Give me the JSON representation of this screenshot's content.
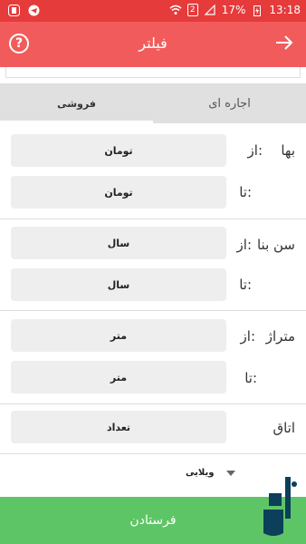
{
  "status_bar": {
    "time": "13:18",
    "battery": "17%",
    "sim_badge": "2"
  },
  "header": {
    "title": "فیلتر"
  },
  "tabs": [
    {
      "label": "فروشی",
      "selected": true
    },
    {
      "label": "اجاره ای",
      "selected": false
    }
  ],
  "filters": {
    "price": {
      "label": "بها",
      "from_label": "از:",
      "to_label": "تا:",
      "from_value": "تومان",
      "to_value": "تومان"
    },
    "age": {
      "label": "سن بنا",
      "from_label": "از:",
      "to_label": "تا:",
      "from_value": "سال",
      "to_value": "سال"
    },
    "area": {
      "label": "متراژ",
      "from_label": "از:",
      "to_label": "تا:",
      "from_value": "متر",
      "to_value": "متر"
    },
    "rooms": {
      "label": "اتاق",
      "value": "تعداد"
    },
    "type": {
      "selected": "ویلایی"
    }
  },
  "submit": {
    "label": "فرستادن"
  },
  "colors": {
    "status_bar": "#e63b3b",
    "app_bar": "#f25b5b",
    "submit": "#5ec566",
    "logo": "#0b3f5a"
  }
}
